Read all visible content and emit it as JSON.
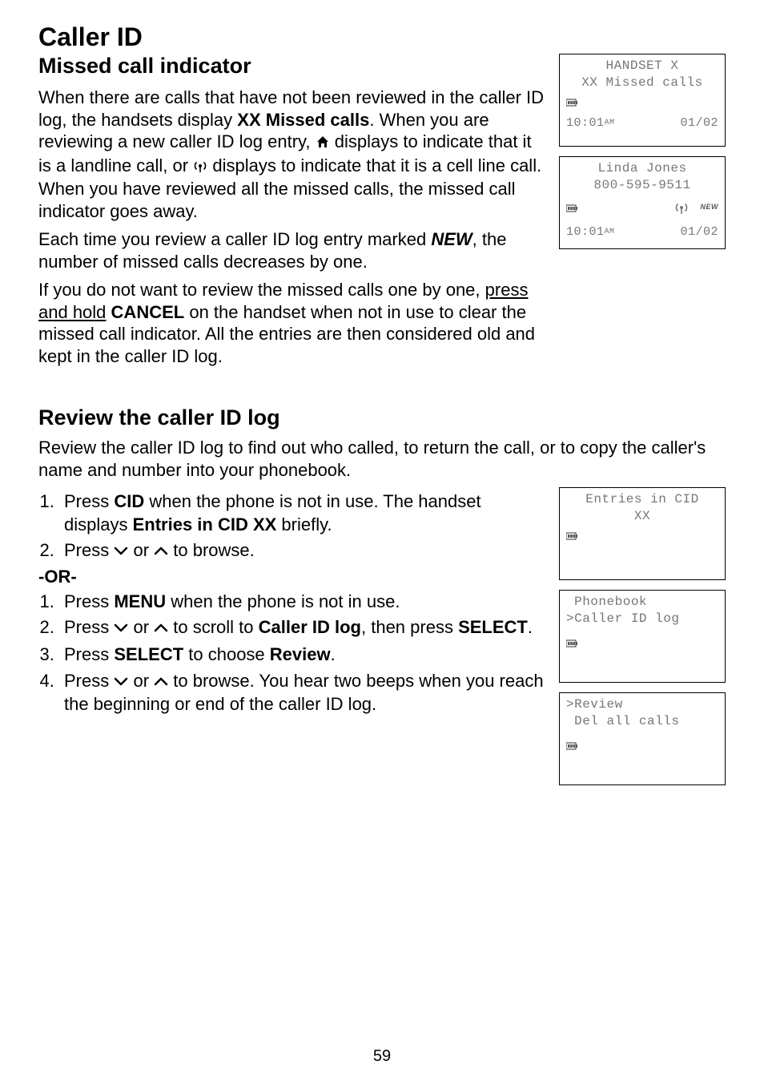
{
  "page": {
    "title": "Caller ID",
    "number": "59"
  },
  "section1": {
    "subtitle": "Missed call indicator",
    "p1a": "When there are calls that have not been reviewed in the caller ID log, the handsets display ",
    "p1b": "XX Missed calls",
    "p1c": ". When you are reviewing a new caller ID log entry, ",
    "p1d": " displays to indicate that it is a landline call, or ",
    "p1e": " displays to indicate that it is a cell line call. When you have reviewed all the missed calls, the missed call indicator goes away.",
    "p2a": "Each time you review a caller ID log entry marked ",
    "p2b": "NEW",
    "p2c": ", the number of missed calls decreases by one.",
    "p3a": "If you do not want to review the missed calls one by one, ",
    "p3b": "press and hold",
    "p3c": " ",
    "p3d": "CANCEL",
    "p3e": " on the handset when not in use to clear the missed call indicator. All the entries are then considered old and kept in the caller ID log."
  },
  "section2": {
    "subtitle": "Review the caller ID log",
    "intro": "Review the caller ID log to find out who called, to return the call, or to copy the caller's name and number into your phonebook.",
    "listA1a": "Press ",
    "listA1b": "CID",
    "listA1c": " when the phone is not in use. The handset displays ",
    "listA1d": "Entries in CID XX",
    "listA1e": " briefly.",
    "listA2a": "Press ",
    "listA2b": " or ",
    "listA2c": " to browse.",
    "or": "-OR-",
    "listB1a": "Press ",
    "listB1b": "MENU",
    "listB1c": " when the phone is not in use.",
    "listB2a": "Press ",
    "listB2b": " or ",
    "listB2c": " to scroll to ",
    "listB2d": "Caller ID log",
    "listB2e": ", then press ",
    "listB2f": "SELECT",
    "listB2g": ".",
    "listB3a": "Press ",
    "listB3b": "SELECT",
    "listB3c": " to choose ",
    "listB3d": "Review",
    "listB3e": ".",
    "listB4a": "Press ",
    "listB4b": " or ",
    "listB4c": " to browse. You hear two beeps when you reach the beginning or end of the caller ID log."
  },
  "screens": {
    "s1": {
      "line1": "HANDSET   X",
      "line2": "XX Missed calls",
      "time": "10:01",
      "ampm": "AM",
      "date": "01/02"
    },
    "s2": {
      "line1": "Linda Jones",
      "line2": "800-595-9511",
      "newBadge": "NEW",
      "time": "10:01",
      "ampm": "AM",
      "date": "01/02"
    },
    "s3": {
      "line1": "Entries in CID",
      "line2": "XX"
    },
    "s4": {
      "line1": " Phonebook",
      "line2": ">Caller ID log"
    },
    "s5": {
      "line1": ">Review",
      "line2": " Del all calls"
    }
  }
}
